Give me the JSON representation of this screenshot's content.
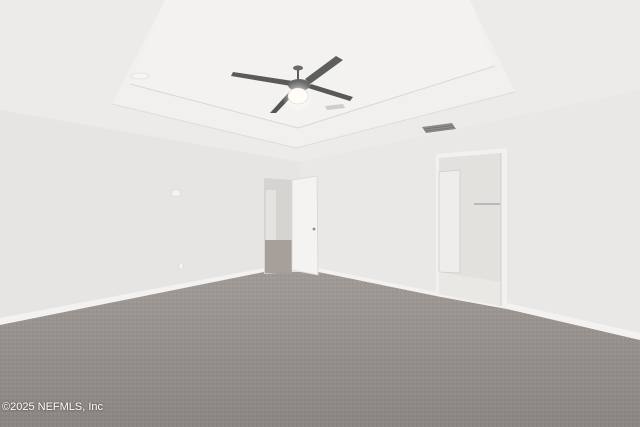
{
  "watermark": {
    "text": "©2025 NEFMLS, Inc"
  },
  "colors": {
    "ceiling": "#ecebe9",
    "tray": "#f2f1ef",
    "wall_left": "#e6e5e3",
    "wall_right": "#e9e8e6",
    "carpet": "#8f8a86",
    "baseboard": "#f3f2f0",
    "doorway": "#d7d5d2",
    "fan_metal": "#5c5c5c",
    "light": "#fffdf6"
  },
  "icons": [
    "ceiling-fan-icon",
    "light-icon",
    "air-vent-icon",
    "door-icon",
    "smoke-detector-icon",
    "outlet-icon"
  ]
}
